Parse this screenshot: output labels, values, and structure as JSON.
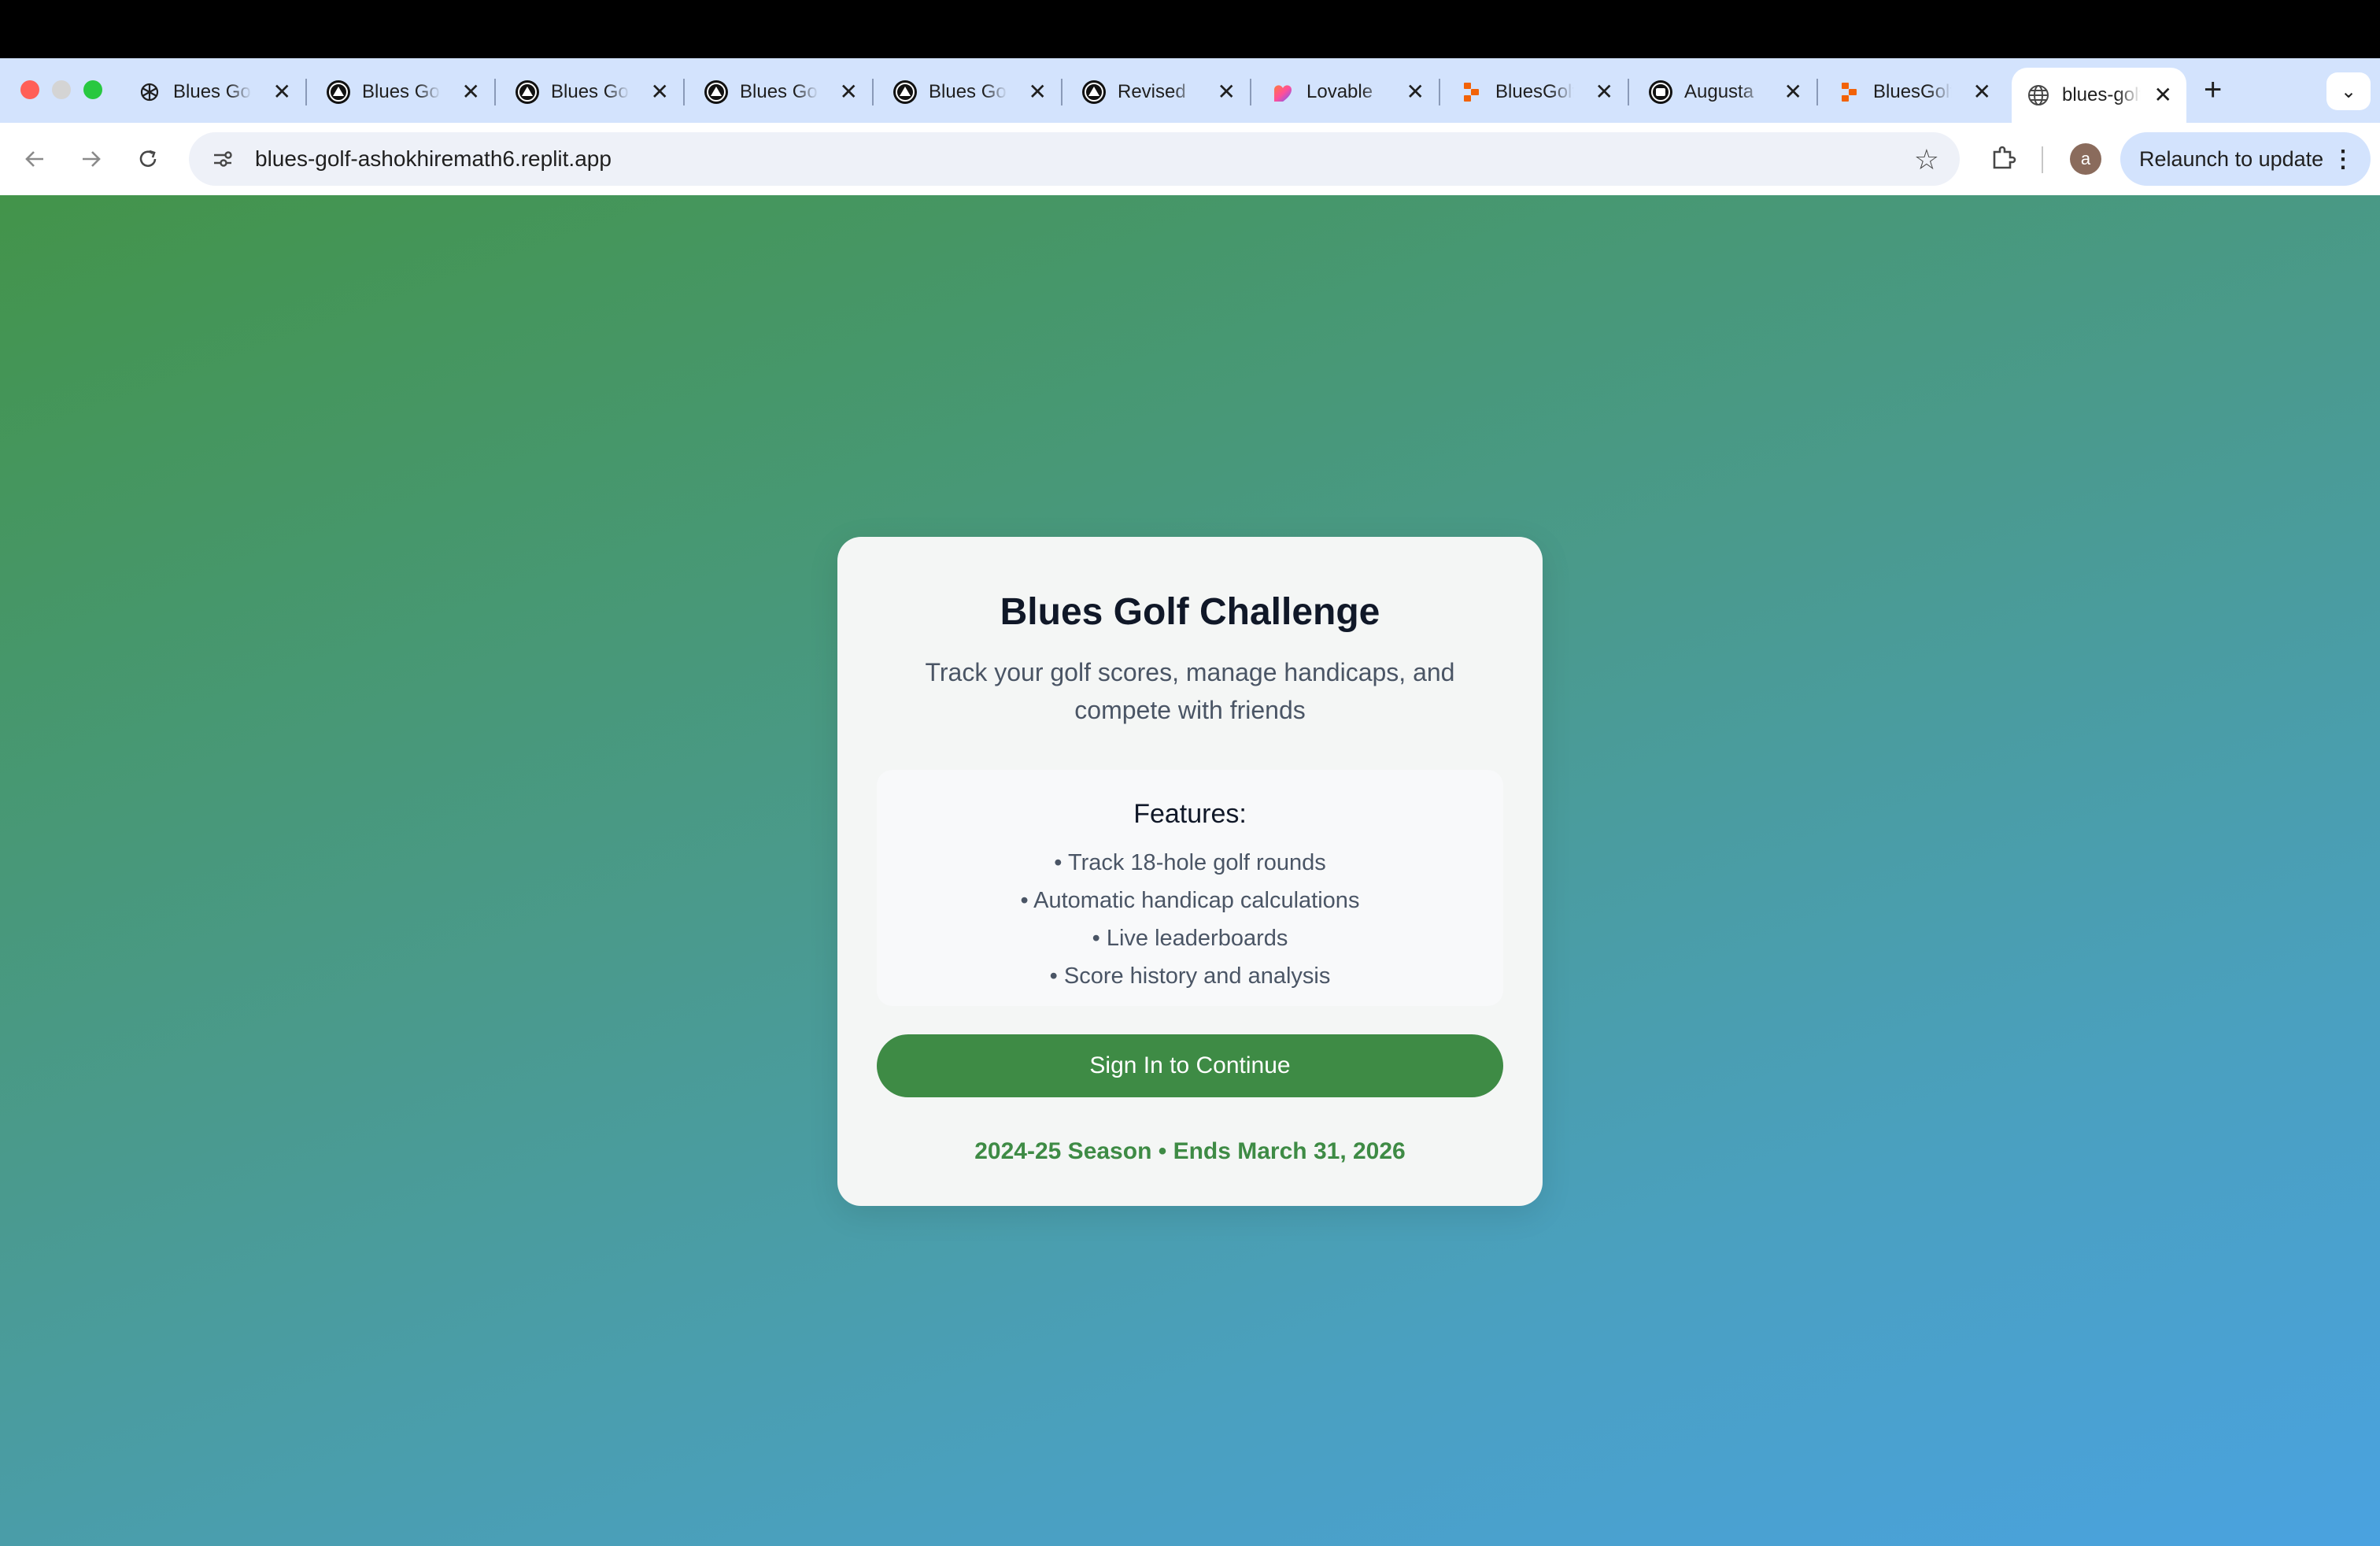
{
  "browser": {
    "tabs": [
      {
        "title": "Blues Golf",
        "icon": "openai-icon"
      },
      {
        "title": "Blues Golf",
        "icon": "triangle-logo-icon"
      },
      {
        "title": "Blues Golf",
        "icon": "triangle-logo-icon"
      },
      {
        "title": "Blues Golf",
        "icon": "triangle-logo-icon"
      },
      {
        "title": "Blues Golf",
        "icon": "triangle-logo-icon"
      },
      {
        "title": "Revised",
        "icon": "triangle-logo-icon"
      },
      {
        "title": "Lovable",
        "icon": "lovable-heart-icon"
      },
      {
        "title": "BluesGolf",
        "icon": "replit-icon"
      },
      {
        "title": "Augusta",
        "icon": "claude-icon"
      },
      {
        "title": "BluesGolf",
        "icon": "replit-icon"
      },
      {
        "title": "blues-golf",
        "icon": "globe-icon",
        "active": true
      }
    ],
    "close_glyph": "✕",
    "new_tab_glyph": "+",
    "tab_menu_glyph": "⌄",
    "url": "blues-golf-ashokhiremath6.replit.app",
    "profile_initial": "a",
    "relaunch_label": "Relaunch to update",
    "relaunch_menu_glyph": "⋮"
  },
  "card": {
    "title": "Blues Golf Challenge",
    "subtitle": "Track your golf scores, manage handicaps, and compete with friends",
    "features_title": "Features:",
    "features": [
      "• Track 18-hole golf rounds",
      "• Automatic handicap calculations",
      "• Live leaderboards",
      "• Score history and analysis"
    ],
    "signin_label": "Sign In to Continue",
    "season": "2024-25 Season • Ends March 31, 2026"
  },
  "colors": {
    "accent_green": "#3e8b45",
    "tabstrip": "#d3e3fd",
    "gradient_start": "#43944a",
    "gradient_end": "#4aa2e0"
  }
}
